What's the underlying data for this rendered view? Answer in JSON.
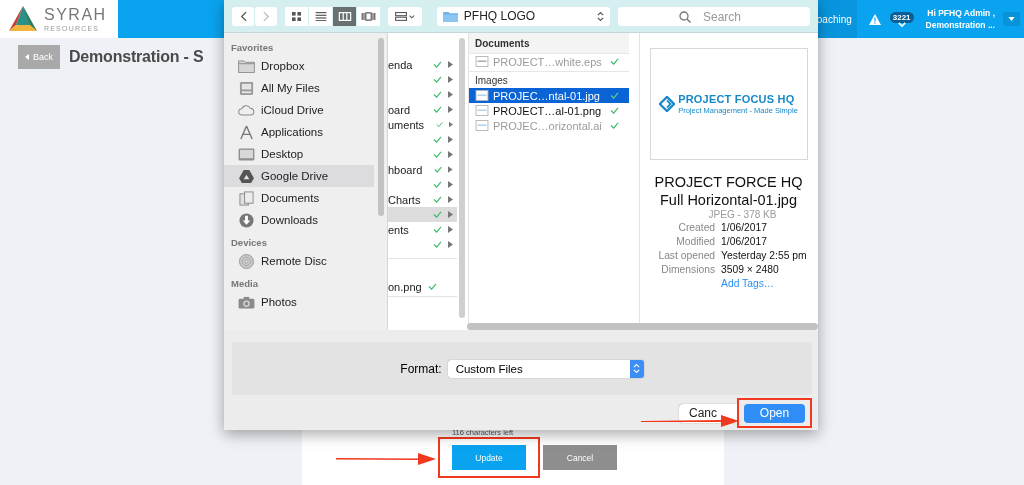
{
  "header": {
    "logo": {
      "name": "SYRAH",
      "tagline": "RESOURCES"
    },
    "nav_item": "oaching",
    "alert_count": "3221",
    "user": {
      "greeting": "Hi PFHQ Admin ,",
      "org": "Demonstration ..."
    }
  },
  "page": {
    "back_button": "Back",
    "title": "Demonstration - S",
    "char_counter": "116 characters left",
    "buttons": [
      {
        "label": "Update",
        "kind": "primary",
        "highlighted": true
      },
      {
        "label": "Cancel",
        "kind": "secondary",
        "highlighted": false
      }
    ]
  },
  "dialog": {
    "toolbar": {
      "views": [
        {
          "selected": false
        },
        {
          "selected": false
        },
        {
          "selected": true
        },
        {
          "selected": false
        }
      ],
      "location": "PFHQ LOGO",
      "search": {
        "placeholder": "Search"
      }
    },
    "sidebar": [
      {
        "title": "Favorites",
        "items": [
          {
            "label": "Dropbox",
            "selected": false
          },
          {
            "label": "All My Files",
            "selected": false
          },
          {
            "label": "iCloud Drive",
            "selected": false
          },
          {
            "label": "Applications",
            "selected": false
          },
          {
            "label": "Desktop",
            "selected": false
          },
          {
            "label": "Google Drive",
            "selected": true
          },
          {
            "label": "Documents",
            "selected": false
          },
          {
            "label": "Downloads",
            "selected": false
          }
        ]
      },
      {
        "title": "Devices",
        "items": [
          {
            "label": "Remote Disc",
            "selected": false
          }
        ]
      },
      {
        "title": "Media",
        "items": [
          {
            "label": "Photos",
            "selected": false
          }
        ]
      }
    ],
    "column_1": {
      "folders": [
        {
          "name": "enda",
          "selected": false
        },
        {
          "selected": false
        },
        {
          "selected": false
        },
        {
          "name": "oard",
          "selected": false
        },
        {
          "name": "uments",
          "selected": false
        },
        {
          "selected": false
        },
        {
          "selected": false
        },
        {
          "name": "hboard",
          "selected": false
        },
        {
          "selected": false
        },
        {
          "name": "Charts",
          "selected": false
        },
        {
          "selected": true
        },
        {
          "name": "ents",
          "selected": false
        },
        {
          "selected": false
        }
      ],
      "files": [
        {
          "name": "on.png"
        }
      ]
    },
    "column_2": [
      {
        "title": "Documents",
        "files": [
          {
            "name": "PROJECT…white.eps",
            "selected": false,
            "disabled": true
          }
        ]
      },
      {
        "title": "Images",
        "files": [
          {
            "name": "PROJEC…ntal-01.jpg",
            "selected": true,
            "disabled": false
          },
          {
            "name": "PROJECT…al-01.png",
            "selected": false,
            "disabled": false
          },
          {
            "name": "PROJEC…orizontal.ai",
            "selected": false,
            "disabled": true
          }
        ]
      }
    ],
    "preview": {
      "image_title": "PROJECT FOCUS HQ",
      "image_tagline": "Project Management - Made Simple",
      "file_name": "PROJECT FORCE HQ Full Horizontal-01.jpg",
      "file_info": "JPEG - 378 KB",
      "details": [
        {
          "label": "Created",
          "value": "1/06/2017"
        },
        {
          "label": "Modified",
          "value": "1/06/2017"
        },
        {
          "label": "Last opened",
          "value": "Yesterday 2:55 pm"
        },
        {
          "label": "Dimensions",
          "value": "3509 × 2480"
        }
      ],
      "add_tags": "Add Tags…"
    },
    "format": {
      "label": "Format:",
      "value": "Custom Files"
    },
    "buttons": [
      {
        "label": "Canc",
        "kind": "secondary",
        "highlighted": false
      },
      {
        "label": "Open",
        "kind": "primary",
        "highlighted": true
      }
    ]
  }
}
